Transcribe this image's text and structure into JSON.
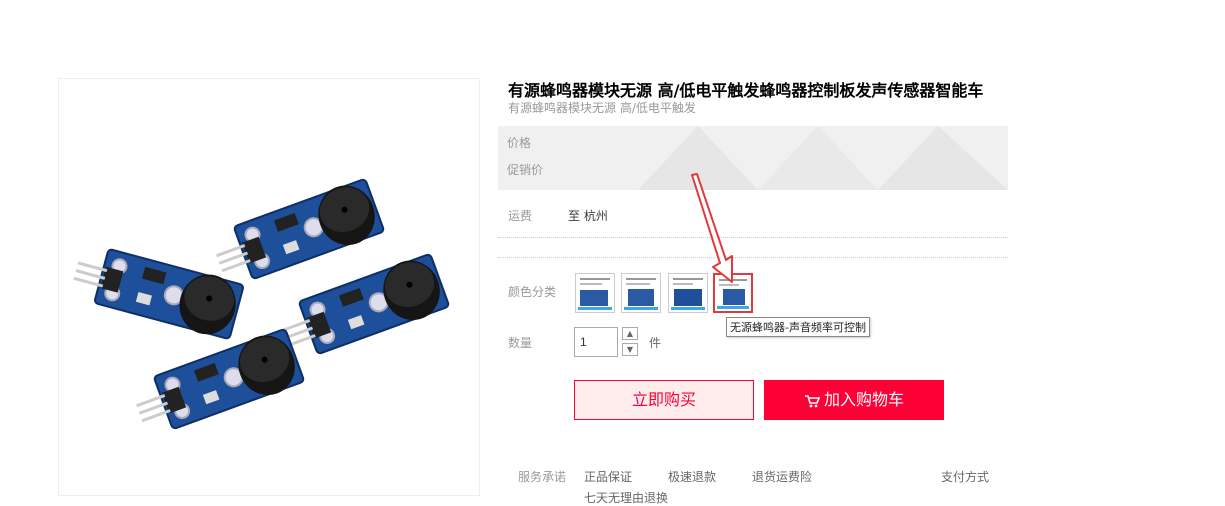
{
  "product": {
    "title": "有源蜂鸣器模块无源 高/低电平触发蜂鸣器控制板发声传感器智能车",
    "subtitle": "有源蜂鸣器模块无源 高/低电平触发"
  },
  "price": {
    "price_label": "价格",
    "promo_label": "促销价"
  },
  "shipping": {
    "label": "运费",
    "value": "至 杭州"
  },
  "color": {
    "label": "颜色分类",
    "options_count": 4,
    "selected_index": 3,
    "tooltip": "无源蜂鸣器-声音频率可控制"
  },
  "quantity": {
    "label": "数量",
    "value": "1",
    "unit": "件"
  },
  "buttons": {
    "buy_now": "立即购买",
    "add_to_cart": "加入购物车"
  },
  "services": {
    "label": "服务承诺",
    "items": [
      "正品保证",
      "极速退款",
      "退货运费险",
      "七天无理由退换"
    ],
    "payment": "支付方式"
  },
  "colors": {
    "accent": "#ff0036",
    "annotation": "#e4393c",
    "pcb_blue": "#1d4f9a"
  },
  "icons": {
    "cart": "cart-icon",
    "stepper_up": "chevron-up-icon",
    "stepper_down": "chevron-down-icon"
  }
}
